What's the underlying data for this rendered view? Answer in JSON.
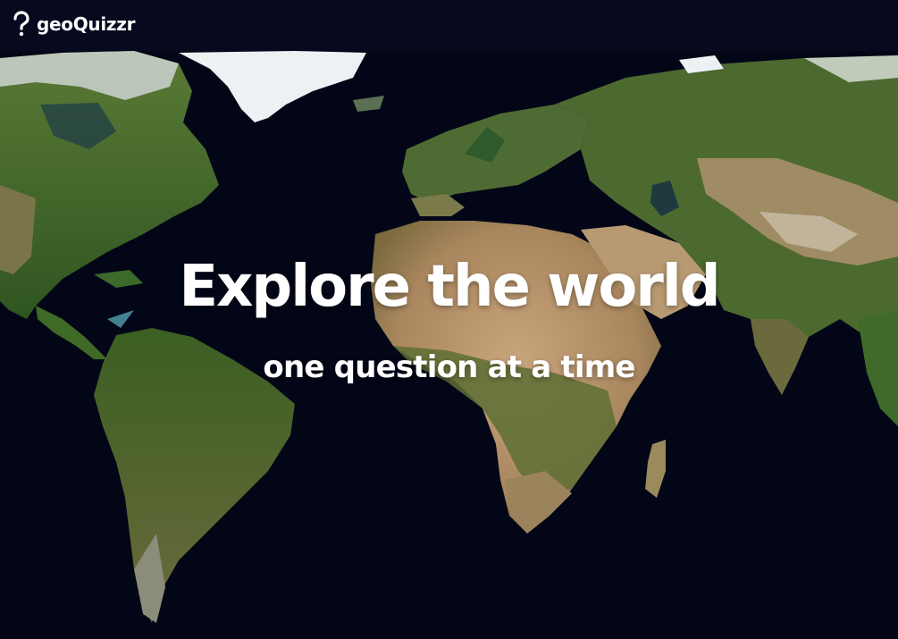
{
  "header": {
    "brand_name": "geoQuizzr",
    "logo_icon": "question-mark-icon"
  },
  "hero": {
    "title": "Explore the world",
    "subtitle": "one question at a time"
  },
  "colors": {
    "header_background": "#070a1e",
    "ocean": "#030617",
    "text": "#ffffff",
    "land_green": "#4b6e2c",
    "land_desert": "#b99570",
    "ice": "#eef1f3"
  }
}
